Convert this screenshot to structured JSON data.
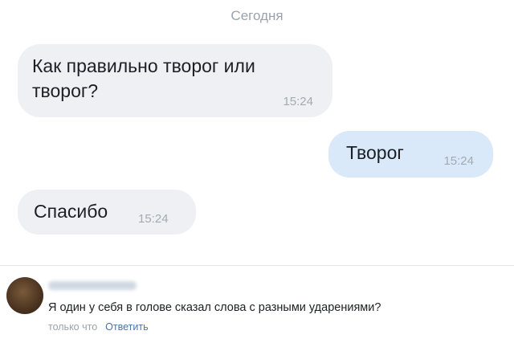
{
  "chat": {
    "date_header": "Сегодня",
    "messages": [
      {
        "direction": "incoming",
        "text": "Как правильно творог или творог?",
        "time": "15:24"
      },
      {
        "direction": "outgoing",
        "text": "Творог",
        "time": "15:24"
      },
      {
        "direction": "incoming",
        "text": "Спасибо",
        "time": "15:24"
      }
    ]
  },
  "comment": {
    "text": "Я один у себя в голове сказал слова с разными ударениями?",
    "timestamp": "только что",
    "reply_label": "Ответить"
  },
  "colors": {
    "incoming_bubble": "#eef0f3",
    "outgoing_bubble": "#d9e9f9",
    "link": "#4a76a8"
  }
}
